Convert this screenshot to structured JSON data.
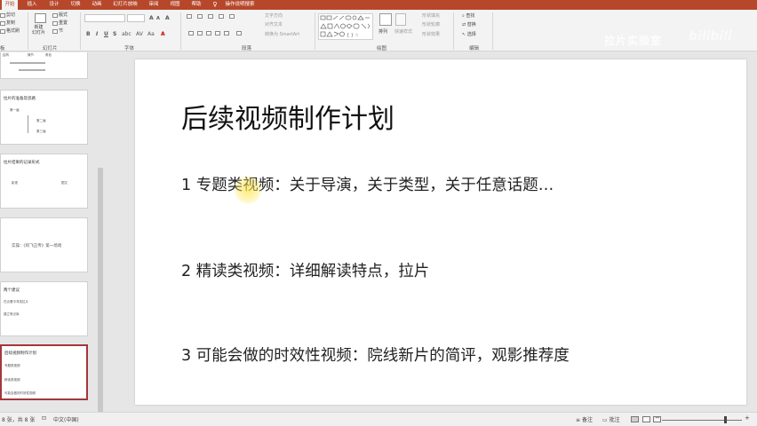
{
  "ribbon_tabs": [
    {
      "label": "开始",
      "active": true
    },
    {
      "label": "插入",
      "active": false
    },
    {
      "label": "设计",
      "active": false
    },
    {
      "label": "切换",
      "active": false
    },
    {
      "label": "动画",
      "active": false
    },
    {
      "label": "幻灯片放映",
      "active": false
    },
    {
      "label": "审阅",
      "active": false
    },
    {
      "label": "视图",
      "active": false
    },
    {
      "label": "帮助",
      "active": false
    },
    {
      "label": "操作说明搜索",
      "active": false
    }
  ],
  "clipboard": {
    "cut": "剪切",
    "copy": "复制",
    "format_painter": "格式刷",
    "group": "板"
  },
  "slides_group": {
    "new_slide": "新建\n幻灯片",
    "layout": "版式",
    "reset": "重置",
    "section": "节",
    "group": "幻灯片"
  },
  "font_group": {
    "group": "字体"
  },
  "paragraph_group": {
    "text_direction": "文字方向",
    "align_text": "对齐文本",
    "smartart": "转换为 SmartArt",
    "group": "段落"
  },
  "drawing_group": {
    "arrange": "排列",
    "quick_styles": "快速样式",
    "shape_fill": "形状填充",
    "shape_outline": "形状轮廓",
    "shape_effects": "形状效果",
    "group": "绘图"
  },
  "editing_group": {
    "find": "查找",
    "replace": "替换",
    "select": "选择",
    "group": "编辑"
  },
  "watermark": {
    "text": "拉片实验室",
    "brand": "bilibili"
  },
  "thumbnails": [
    {
      "title": "",
      "lines": [
        "结构",
        "情节",
        "角色"
      ]
    },
    {
      "title": "拉片的准备及思路",
      "lines": [
        "第一遍",
        "第二遍",
        "第三遍"
      ]
    },
    {
      "title": "拉片结果的记录形式",
      "lines": [
        "影视",
        "图文"
      ]
    },
    {
      "title": "",
      "lines": [
        "实操：《阿飞正传》第一场戏"
      ]
    },
    {
      "title": "两个建议",
      "lines": [
        "在泛看中寻找拉片",
        "建立笔记库"
      ]
    },
    {
      "title": "后续视频制作计划",
      "lines": [
        "专题类视频",
        "精读类视频",
        "可能会做的时效性视频"
      ]
    }
  ],
  "slide": {
    "title": "后续视频制作计划",
    "bullets": [
      "1 专题类视频：关于导演，关于类型，关于任意话题…",
      "2 精读类视频：详细解读特点，拉片",
      "3 可能会做的时效性视频：院线新片的简评，观影推荐度"
    ]
  },
  "statusbar": {
    "slide_counter": "8 张，共 8 张",
    "language": "中文(中国)",
    "notes": "备注",
    "comments": "批注"
  }
}
